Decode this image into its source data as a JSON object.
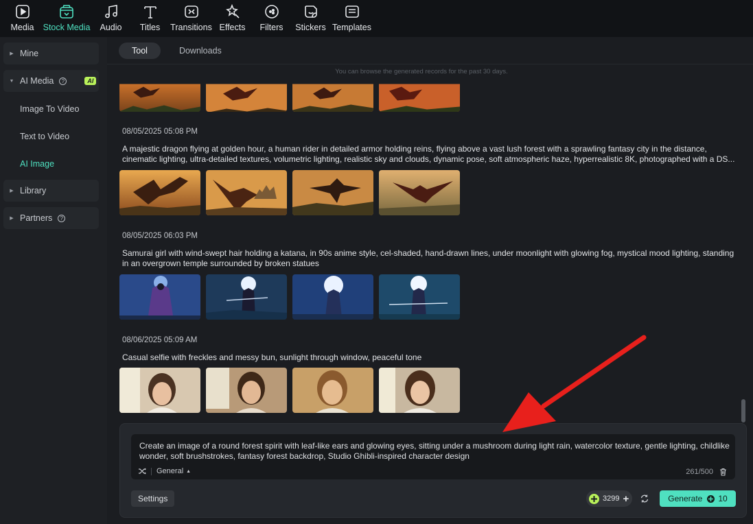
{
  "toolbar": {
    "items": [
      {
        "label": "Media",
        "icon": "media-icon"
      },
      {
        "label": "Stock Media",
        "icon": "stock-media-icon"
      },
      {
        "label": "Audio",
        "icon": "audio-icon"
      },
      {
        "label": "Titles",
        "icon": "titles-icon"
      },
      {
        "label": "Transitions",
        "icon": "transitions-icon"
      },
      {
        "label": "Effects",
        "icon": "effects-icon"
      },
      {
        "label": "Filters",
        "icon": "filters-icon"
      },
      {
        "label": "Stickers",
        "icon": "stickers-icon"
      },
      {
        "label": "Templates",
        "icon": "templates-icon"
      }
    ],
    "active": "Stock Media"
  },
  "sidebar": {
    "mine": "Mine",
    "ai_media": "AI Media",
    "ai_badge": "AI",
    "sub": [
      "Image To Video",
      "Text to Video",
      "AI Image"
    ],
    "active_sub": "AI Image",
    "library": "Library",
    "partners": "Partners"
  },
  "tabs": {
    "tool": "Tool",
    "downloads": "Downloads"
  },
  "hint": "You can browse the generated records for the past 30 days.",
  "records": [
    {
      "time": "08/05/2025 05:08 PM",
      "prompt": "A majestic dragon flying at golden hour, a human rider in detailed armor holding reins, flying above a vast lush forest with a sprawling fantasy city in the distance, cinematic lighting, ultra-detailed textures, volumetric lighting, realistic sky and clouds, dynamic pose, soft atmospheric haze, hyperrealistic 8K, photographed with a DS..."
    },
    {
      "time": "08/05/2025 06:03 PM",
      "prompt": "Samurai girl with wind-swept hair holding a katana, in 90s anime style, cel-shaded, hand-drawn lines, under moonlight with glowing fog, mystical mood lighting, standing in an overgrown temple surrounded by broken statues"
    },
    {
      "time": "08/06/2025 05:09 AM",
      "prompt": "Casual selfie with freckles and messy bun, sunlight through window, peaceful tone"
    }
  ],
  "composer": {
    "prompt": "Create an image of a round forest spirit with leaf-like ears and glowing eyes, sitting under a mushroom during light rain, watercolor texture, gentle lighting, childlike wonder, soft brushstrokes, fantasy forest backdrop, Studio Ghibli-inspired character design",
    "style": "General",
    "counter": "261/500",
    "settings_label": "Settings",
    "credits": "3299",
    "generate_label": "Generate",
    "generate_cost": "10"
  },
  "colors": {
    "accent": "#4fe0c0",
    "badge": "#b9f25a",
    "arrow": "#e8201c"
  }
}
